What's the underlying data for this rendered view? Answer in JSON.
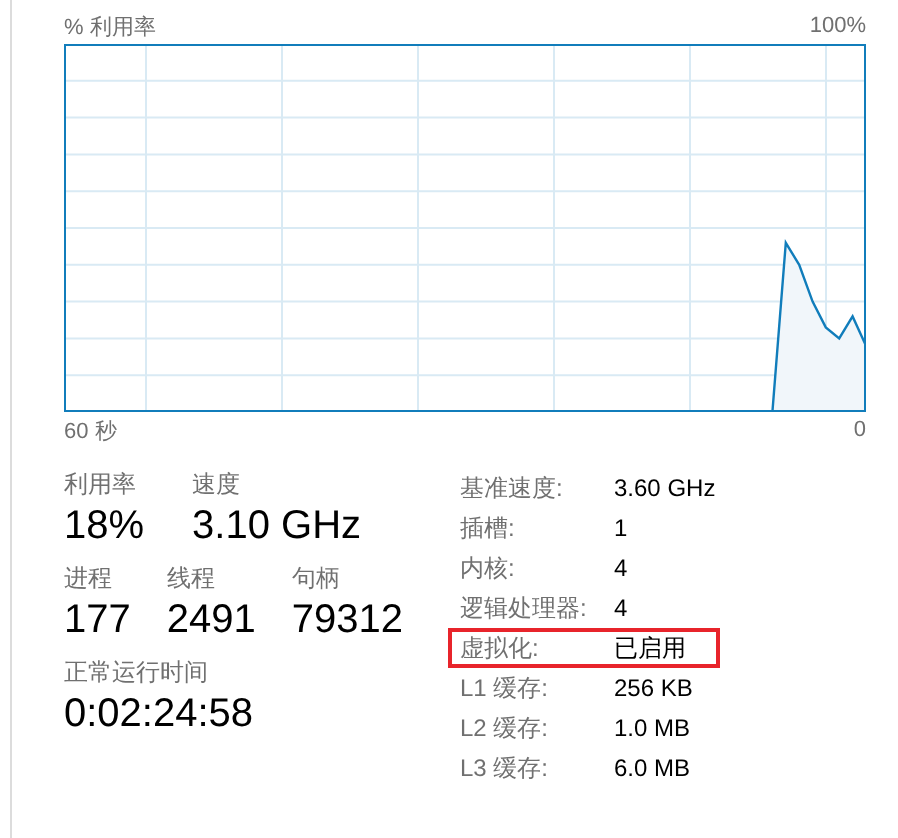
{
  "chart": {
    "title": "% 利用率",
    "max_label": "100%",
    "time_span_label": "60 秒",
    "end_label": "0"
  },
  "stats": [
    [
      {
        "label": "利用率",
        "value": "18%"
      },
      {
        "label": "速度",
        "value": "3.10 GHz"
      }
    ],
    [
      {
        "label": "进程",
        "value": "177"
      },
      {
        "label": "线程",
        "value": "2491"
      },
      {
        "label": "句柄",
        "value": "79312"
      }
    ],
    [
      {
        "label": "正常运行时间",
        "value": "0:02:24:58"
      }
    ]
  ],
  "details": [
    {
      "label": "基准速度:",
      "value": "3.60 GHz",
      "highlighted": false
    },
    {
      "label": "插槽:",
      "value": "1",
      "highlighted": false
    },
    {
      "label": "内核:",
      "value": "4",
      "highlighted": false
    },
    {
      "label": "逻辑处理器:",
      "value": "4",
      "highlighted": false
    },
    {
      "label": "虚拟化:",
      "value": "已启用",
      "highlighted": true
    },
    {
      "label": "L1 缓存:",
      "value": "256 KB",
      "highlighted": false
    },
    {
      "label": "L2 缓存:",
      "value": "1.0 MB",
      "highlighted": false
    },
    {
      "label": "L3 缓存:",
      "value": "6.0 MB",
      "highlighted": false
    }
  ]
}
